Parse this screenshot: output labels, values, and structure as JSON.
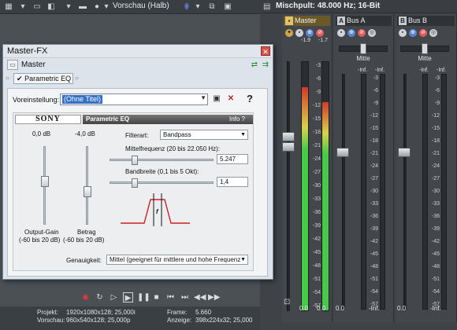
{
  "toolbar": {
    "preview_mode": "Vorschau (Halb)"
  },
  "mixer": {
    "title": "Mischpult: 48.000 Hz; 16-Bit",
    "master": {
      "label": "Master",
      "pan_label": "",
      "peaks": [
        "-1.9",
        "-1.7"
      ],
      "foot_left": "0.0",
      "foot_right": "0.0",
      "meter_levels": [
        0.9,
        0.84
      ]
    },
    "bus_a": {
      "letter": "A",
      "label": "Bus A",
      "pan_label": "Mitte",
      "peaks": [
        "-Inf.",
        "-Inf."
      ],
      "foot_left": "0.0",
      "foot_right": "-Inf.",
      "fader_db": "0.0"
    },
    "bus_b": {
      "letter": "B",
      "label": "Bus B",
      "pan_label": "Mitte",
      "peaks": [
        "-Inf.",
        "-Inf."
      ],
      "foot_left": "0.0",
      "foot_right": "-Inf.",
      "fader_db": "0.0"
    },
    "scale": [
      "3",
      "6",
      "9",
      "12",
      "15",
      "18",
      "21",
      "24",
      "27",
      "30",
      "33",
      "36",
      "39",
      "42",
      "45",
      "48",
      "51",
      "54",
      "57"
    ]
  },
  "dialog": {
    "title": "Master-FX",
    "chain_label": "Master",
    "plugin_label": "Parametric EQ",
    "preset_label": "Voreinstellung:",
    "preset_value": "(Ohne Titel)",
    "help_icon": "?"
  },
  "eq": {
    "brand": "SONY",
    "name": "Parametric EQ",
    "info": "Info",
    "info_q": "?",
    "output_gain_value": "0,0 dB",
    "output_gain_label": "Output-Gain",
    "output_gain_range": "(-60 bis 20 dB)",
    "amount_value": "-4,0 dB",
    "amount_label": "Betrag",
    "amount_range": "(-60 bis 20 dB)",
    "filter_label": "Filterart:",
    "filter_value": "Bandpass",
    "center_label": "Mittelfrequenz (20 bis 22.050 Hz):",
    "center_value": "5.247",
    "bandwidth_label": "Bandbreite (0,1 bis 5 Okt):",
    "bandwidth_value": "1,4",
    "curve_label": "f",
    "accuracy_label": "Genauigkeit:",
    "accuracy_value": "Mittel (geeignet für mittlere und hohe Frequenze"
  },
  "status": {
    "project_label": "Projekt:",
    "project_value": "1920x1080x128; 25,000i",
    "preview_label": "Vorschau:",
    "preview_value": "960x540x128; 25,000p",
    "frame_label": "Frame:",
    "frame_value": "5.660",
    "display_label": "Anzeige:",
    "display_value": "398x224x32; 25,000"
  },
  "colors": {
    "meter_green": "#47c94a",
    "meter_yellow": "#d9d24a",
    "meter_red": "#d13a2a",
    "accent": "#3470c4"
  }
}
